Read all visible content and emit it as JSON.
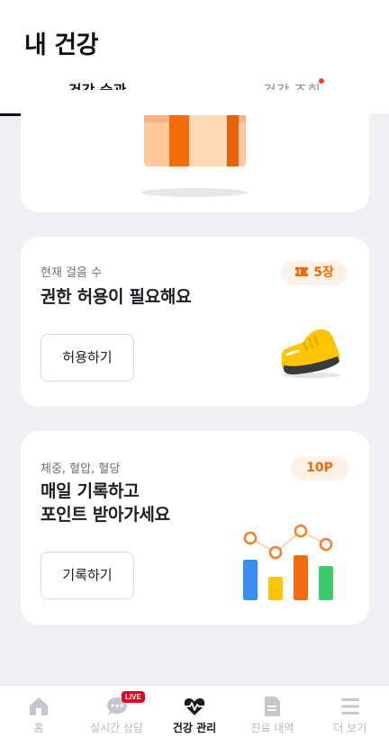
{
  "header": {
    "title": "내 건강"
  },
  "tabs": [
    {
      "label": "건강 습관",
      "active": true
    },
    {
      "label": "건강 조회",
      "active": false,
      "has_new_dot": true
    }
  ],
  "steps_card": {
    "subtitle": "현재 걸음 수",
    "title": "권한 허용이 필요해요",
    "badge": "5장",
    "button": "허용하기",
    "icon": "sneaker-icon"
  },
  "record_card": {
    "subtitle": "체중, 혈압, 혈당",
    "title_line1": "매일 기록하고",
    "title_line2": "포인트 받아가세요",
    "badge": "10P",
    "button": "기록하기",
    "icon": "bar-chart-icon"
  },
  "colors": {
    "accent_orange": "#f06a00",
    "badge_bg": "#fff1e6",
    "live_red": "#e60023",
    "background": "#eef0f4"
  },
  "bottom_nav": [
    {
      "label": "홈",
      "icon": "home-icon",
      "active": false
    },
    {
      "label": "실시간 상담",
      "icon": "chat-bubble-icon",
      "badge": "LIVE",
      "active": false
    },
    {
      "label": "건강 관리",
      "icon": "heart-pulse-icon",
      "active": true
    },
    {
      "label": "진료 내역",
      "icon": "document-icon",
      "active": false
    },
    {
      "label": "더 보기",
      "icon": "menu-icon",
      "active": false
    }
  ]
}
